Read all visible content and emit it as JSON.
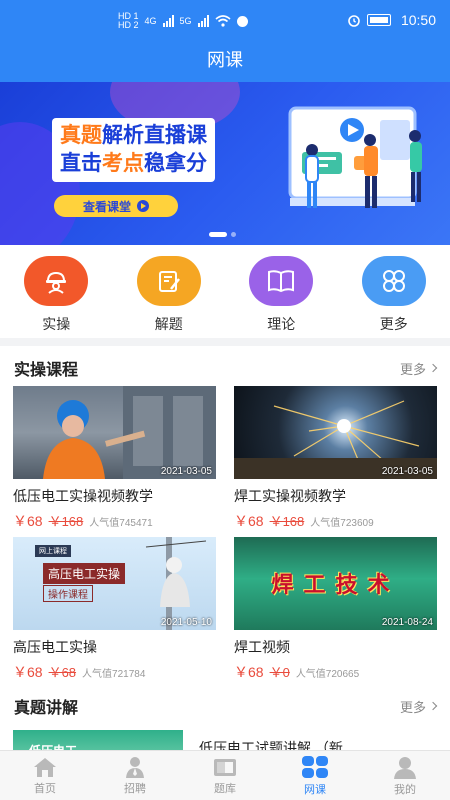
{
  "status": {
    "time": "10:50",
    "hd1": "HD 1",
    "hd2": "HD 2",
    "net1": "4G",
    "net2": "5G"
  },
  "header": {
    "title": "网课"
  },
  "banner": {
    "line1_a": "真题",
    "line1_b": "解析直播课",
    "line2_a": "直击",
    "line2_b": "考点",
    "line2_c": "稳拿分",
    "cta": "查看课堂"
  },
  "quick_nav": [
    {
      "label": "实操",
      "color": "#f2582a",
      "icon": "worker-icon"
    },
    {
      "label": "解题",
      "color": "#f5a623",
      "icon": "edit-note-icon"
    },
    {
      "label": "理论",
      "color": "#9a62e8",
      "icon": "book-icon"
    },
    {
      "label": "更多",
      "color": "#4a9cf4",
      "icon": "grid-icon"
    }
  ],
  "practice": {
    "title": "实操课程",
    "more": "更多",
    "courses": [
      {
        "name": "低压电工实操视频教学",
        "date": "2021-03-05",
        "price": "￥68",
        "orig": "￥168",
        "pop": "人气值745471"
      },
      {
        "name": "焊工实操视频教学",
        "date": "2021-03-05",
        "price": "￥68",
        "orig": "￥168",
        "pop": "人气值723609"
      },
      {
        "name": "高压电工实操",
        "date": "2021-05-10",
        "price": "￥68",
        "orig": "￥68",
        "pop": "人气值721784",
        "thumb_text1": "高压电工实操",
        "thumb_text2": "操作课程",
        "thumb_tag": "网上课程"
      },
      {
        "name": "焊工视频",
        "date": "2021-08-24",
        "price": "￥68",
        "orig": "￥0",
        "pop": "人气值720665",
        "thumb_text": "焊工技术"
      }
    ]
  },
  "exam": {
    "title": "真题讲解",
    "more": "更多",
    "item": {
      "name": "低压电工试题讲解 （新...",
      "thumb_text": "低压电工"
    }
  },
  "tabs": [
    {
      "label": "首页",
      "icon": "home-icon"
    },
    {
      "label": "招聘",
      "icon": "recruit-icon"
    },
    {
      "label": "题库",
      "icon": "question-bank-icon"
    },
    {
      "label": "网课",
      "icon": "online-course-icon",
      "active": true
    },
    {
      "label": "我的",
      "icon": "profile-icon"
    }
  ]
}
